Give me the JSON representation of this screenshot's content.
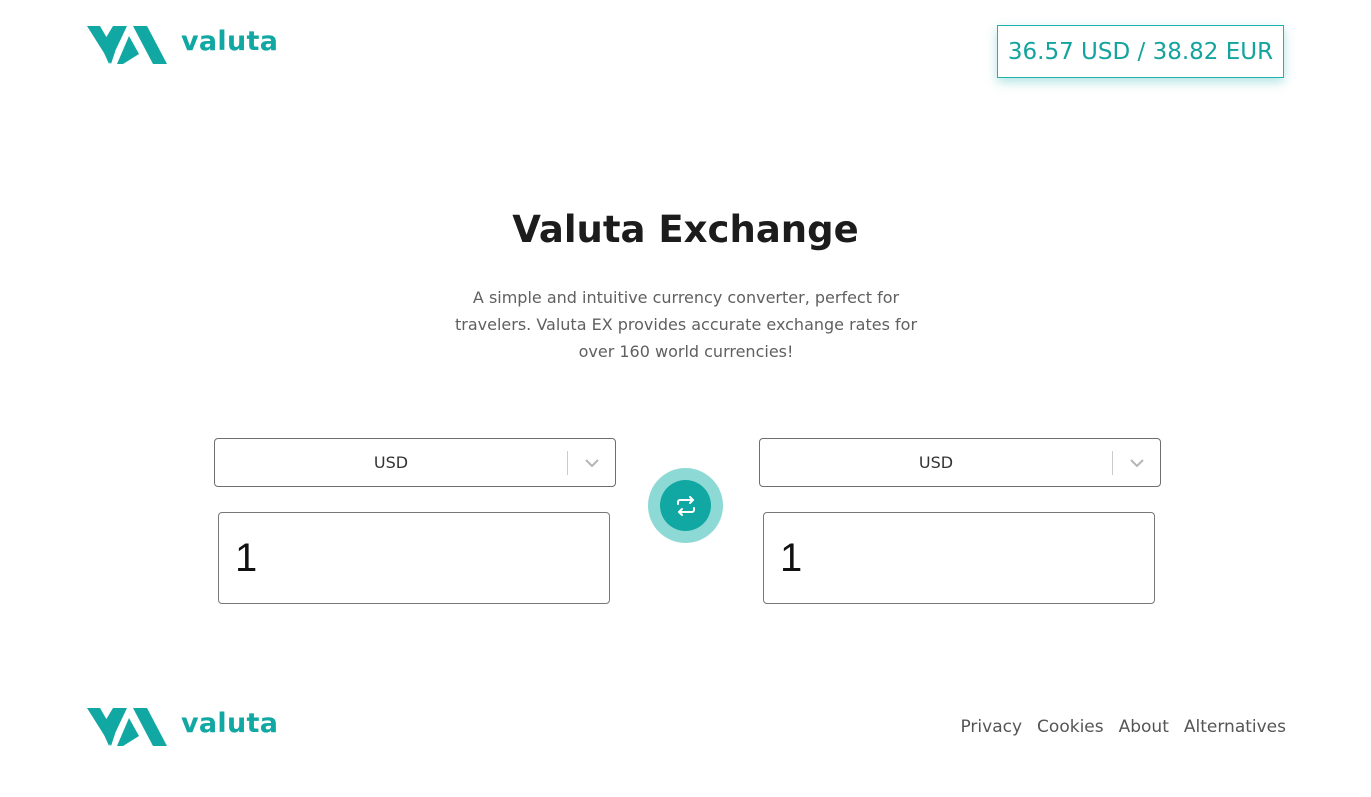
{
  "header": {
    "logo_text": "valuta",
    "rate_display": "36.57 USD / 38.82 EUR"
  },
  "main": {
    "title": "Valuta Exchange",
    "description": "A simple and intuitive currency converter, perfect for travelers. Valuta EX provides accurate exchange rates for over 160 world currencies!",
    "from": {
      "currency": "USD",
      "amount": "1"
    },
    "to": {
      "currency": "USD",
      "amount": "1"
    },
    "swap_icon": "swap-arrows-icon"
  },
  "footer": {
    "logo_text": "valuta",
    "links": [
      "Privacy",
      "Cookies",
      "About",
      "Alternatives"
    ]
  },
  "colors": {
    "brand": "#11a7a2",
    "brand_light": "#8dd9d6",
    "text_muted": "#606060"
  }
}
